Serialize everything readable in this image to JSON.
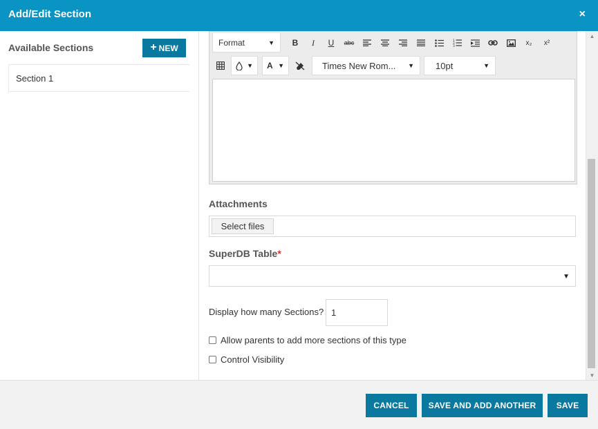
{
  "dialog": {
    "title": "Add/Edit Section",
    "close_glyph": "×"
  },
  "sidebar": {
    "heading": "Available Sections",
    "new_button_icon": "+",
    "new_button_label": "NEW",
    "items": [
      {
        "label": "Section 1"
      }
    ]
  },
  "editor": {
    "format_label": "Format",
    "font_family": "Times New Rom...",
    "font_size": "10pt",
    "caret_glyph": "▼",
    "toolbar_icons": [
      "bold-icon",
      "italic-icon",
      "underline-icon",
      "strikethrough-icon",
      "align-left-icon",
      "align-center-icon",
      "align-right-icon",
      "align-justify-icon",
      "bullet-list-icon",
      "numbered-list-icon",
      "indent-icon",
      "link-icon",
      "image-icon",
      "subscript-icon",
      "superscript-icon",
      "table-icon",
      "background-color-icon",
      "font-color-icon",
      "clear-formatting-icon"
    ],
    "glyphs": {
      "bold": "B",
      "italic": "I",
      "underline": "U",
      "strike": "abc",
      "sub": "x₂",
      "sup": "x²",
      "font_color": "A"
    },
    "content": ""
  },
  "attachments": {
    "label": "Attachments",
    "select_files_label": "Select files"
  },
  "superdb": {
    "label": "SuperDB Table",
    "required_mark": "*",
    "value": "",
    "caret_glyph": "▼"
  },
  "sections_count": {
    "label": "Display how many Sections?",
    "value": "1"
  },
  "options": [
    {
      "label": "Allow parents to add more sections of this type",
      "checked": false
    },
    {
      "label": "Control Visibility",
      "checked": false
    }
  ],
  "scrollbar": {
    "up_glyph": "▲",
    "down_glyph": "▼"
  },
  "footer": {
    "cancel_label": "CANCEL",
    "save_add_label": "SAVE AND ADD ANOTHER",
    "save_label": "SAVE"
  },
  "colors": {
    "header": "#0a94c4",
    "button": "#0a79a0",
    "footer_bg": "#f2f2f2",
    "required": "#d0312d"
  }
}
